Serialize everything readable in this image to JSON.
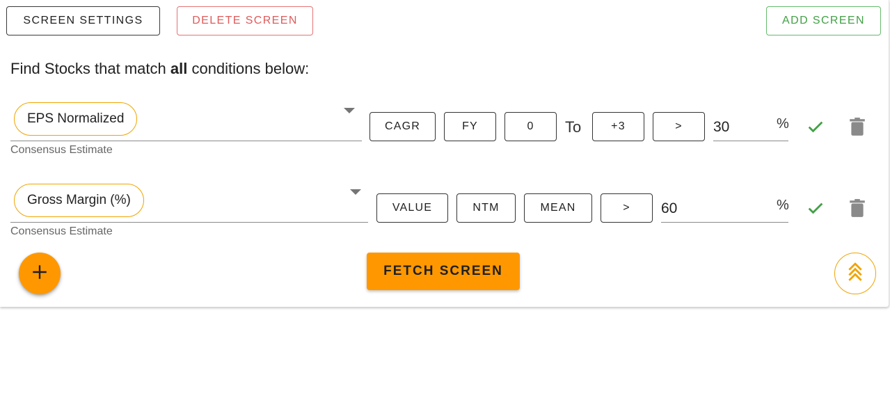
{
  "toolbar": {
    "screen_settings": "SCREEN SETTINGS",
    "delete_screen": "DELETE SCREEN",
    "add_screen": "ADD SCREEN"
  },
  "heading": {
    "prefix": "Find Stocks that match ",
    "emphasis": "all",
    "suffix": " conditions below:"
  },
  "conditions": [
    {
      "metric": "EPS Normalized",
      "helper": "Consensus Estimate",
      "options": [
        "CAGR",
        "FY",
        "0"
      ],
      "to_label": "To",
      "range_end": "+3",
      "operator": ">",
      "value": "30",
      "unit": "%"
    },
    {
      "metric": "Gross Margin (%)",
      "helper": "Consensus Estimate",
      "options": [
        "VALUE",
        "NTM",
        "MEAN"
      ],
      "operator": ">",
      "value": "60",
      "unit": "%"
    }
  ],
  "actions": {
    "fetch_screen": "FETCH SCREEN"
  },
  "icons": {
    "add": "plus-icon",
    "confirm": "check-icon",
    "delete": "trash-icon",
    "scroll_top": "double-chevron-up-icon"
  },
  "colors": {
    "accent": "#ff9800",
    "danger": "#e05a5a",
    "success": "#43a047"
  }
}
